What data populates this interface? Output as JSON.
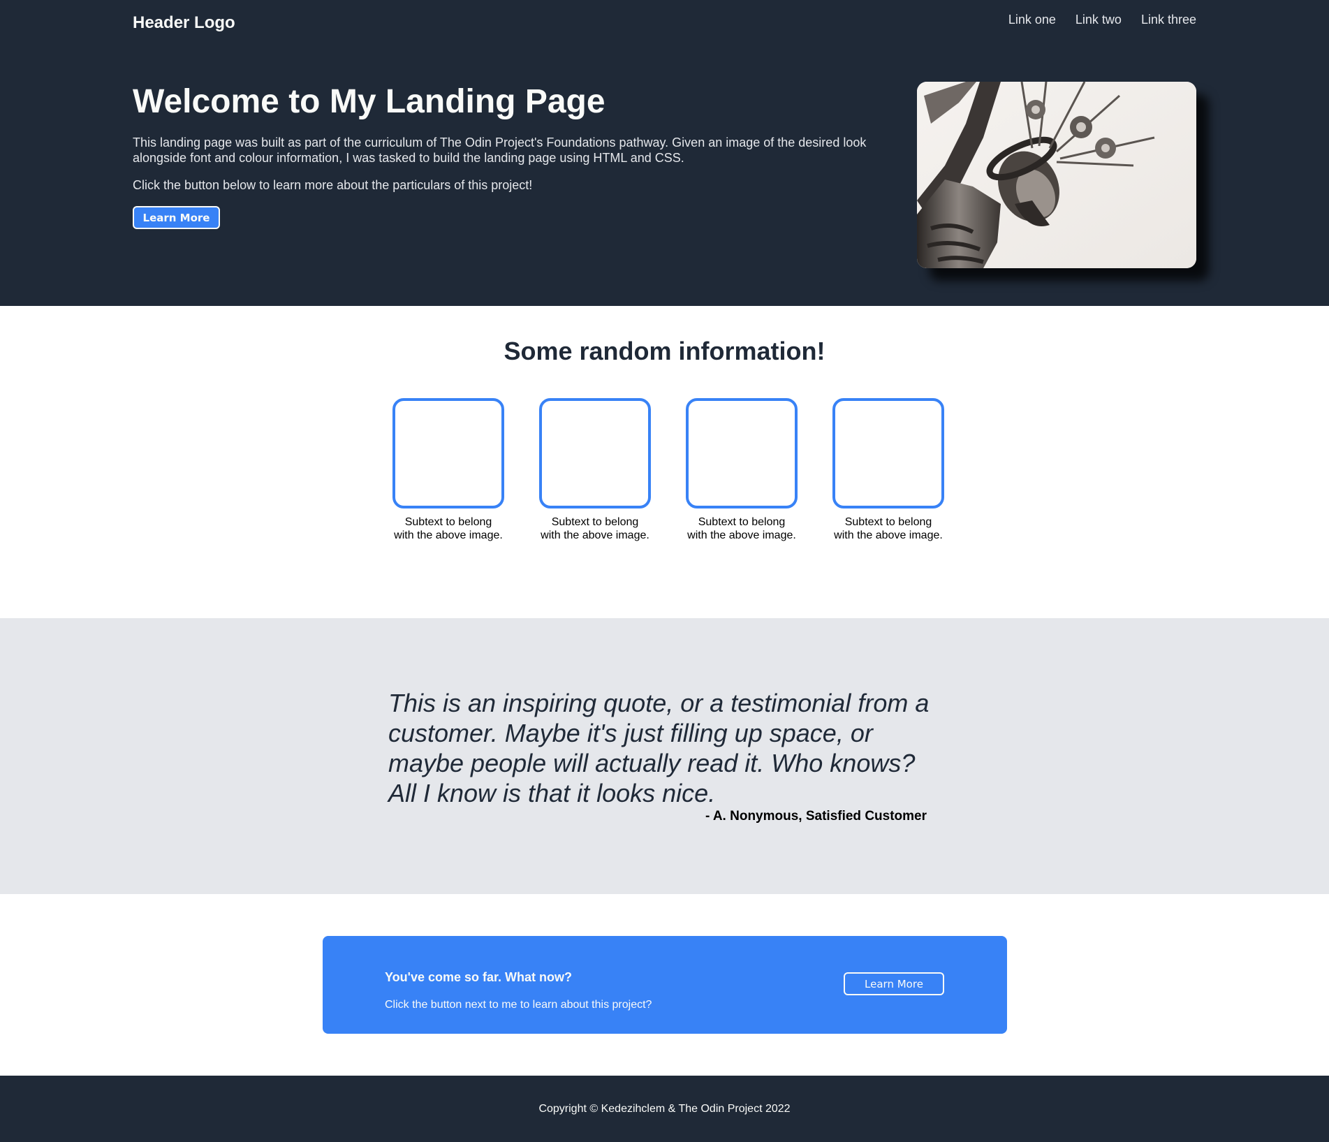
{
  "header": {
    "logo": "Header Logo",
    "nav": [
      "Link one",
      "Link two",
      "Link three"
    ]
  },
  "hero": {
    "title": "Welcome to My Landing Page",
    "paragraph1": "This landing page was built as part of the curriculum of The Odin Project's Foundations pathway. Given an image of the desired look alongside font and colour information, I was tasked to build the landing page using HTML and CSS.",
    "paragraph2": "Click the button below to learn more about the particulars of this project!",
    "button_label": "Learn More",
    "image_icon": "crucifix-statue-photo"
  },
  "info": {
    "title": "Some random information!",
    "cards": [
      {
        "line1": "Subtext to belong",
        "line2": "with the above image."
      },
      {
        "line1": "Subtext to belong",
        "line2": "with the above image."
      },
      {
        "line1": "Subtext to belong",
        "line2": "with the above image."
      },
      {
        "line1": "Subtext to belong",
        "line2": "with the above image."
      }
    ]
  },
  "quote": {
    "text": "This is an inspiring quote, or a testimonial from a customer. Maybe it's just filling up space, or maybe people will actually read it. Who knows? All I know is that it looks nice.",
    "author": "- A. Nonymous, Satisfied Customer"
  },
  "cta": {
    "title": "You've come so far. What now?",
    "text": "Click the button next to me to learn about this project?",
    "button_label": "Learn More"
  },
  "footer": {
    "copyright": "Copyright © Kedezihclem & The Odin Project 2022"
  },
  "colors": {
    "dark": "#1f2937",
    "accent": "#3882f6",
    "light": "#f9faf8",
    "gray": "#e5e7eb"
  }
}
